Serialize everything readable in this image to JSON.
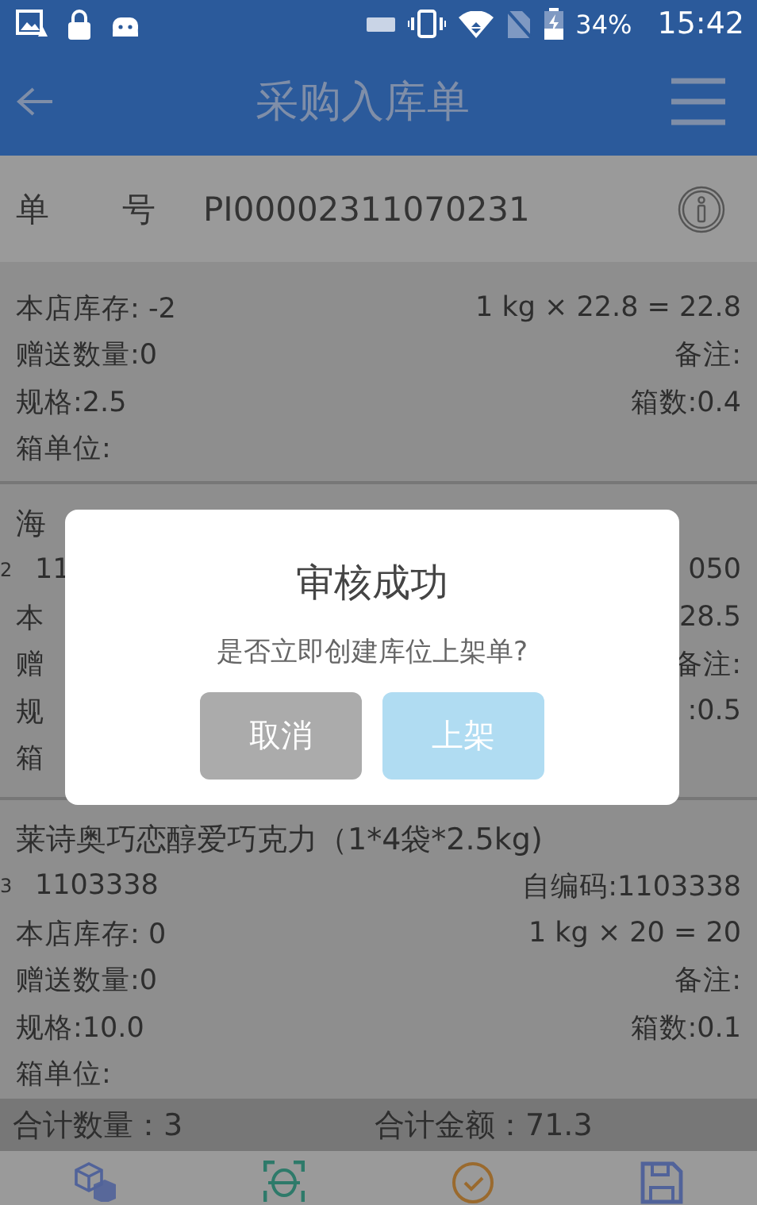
{
  "status_bar": {
    "battery": "34%",
    "time": "15:42"
  },
  "header": {
    "title": "采购入库单"
  },
  "order": {
    "label_1": "单",
    "label_2": "号",
    "number": "PI00002311070231"
  },
  "items": [
    {
      "stock": "本店库存: -2",
      "calc": "1 kg  × 22.8 = 22.8",
      "gift": "赠送数量:0",
      "remark": "备注:",
      "spec": "规格:2.5",
      "boxes": "箱数:0.4",
      "box_unit": "箱单位:"
    },
    {
      "title": "海",
      "index": "2",
      "code": "11",
      "self_code": "050",
      "stock": "本",
      "calc": "28.5",
      "gift": "赠",
      "remark": "备注:",
      "spec": "规",
      "boxes": ":0.5",
      "box_unit": "箱"
    },
    {
      "title": "莱诗奥巧恋醇爱巧克力（1*4袋*2.5kg)",
      "index": "3",
      "code": "1103338",
      "self_code": "自编码:1103338",
      "stock": "本店库存: 0",
      "calc": "1 kg  × 20 = 20",
      "gift": "赠送数量:0",
      "remark": "备注:",
      "spec": "规格:10.0",
      "boxes": "箱数:0.1",
      "box_unit": "箱单位:"
    }
  ],
  "totals": {
    "quantity": "合计数量：3",
    "amount": "合计金额：71.3"
  },
  "toolbar": [
    {
      "kind": "cubes"
    },
    {
      "kind": "scan"
    },
    {
      "kind": "check"
    },
    {
      "kind": "save"
    }
  ],
  "dialog": {
    "title": "审核成功",
    "message": "是否立即创建库位上架单?",
    "buttons": [
      {
        "label": "取消",
        "kind": "cancel"
      },
      {
        "label": "上架",
        "kind": "ok"
      }
    ]
  }
}
